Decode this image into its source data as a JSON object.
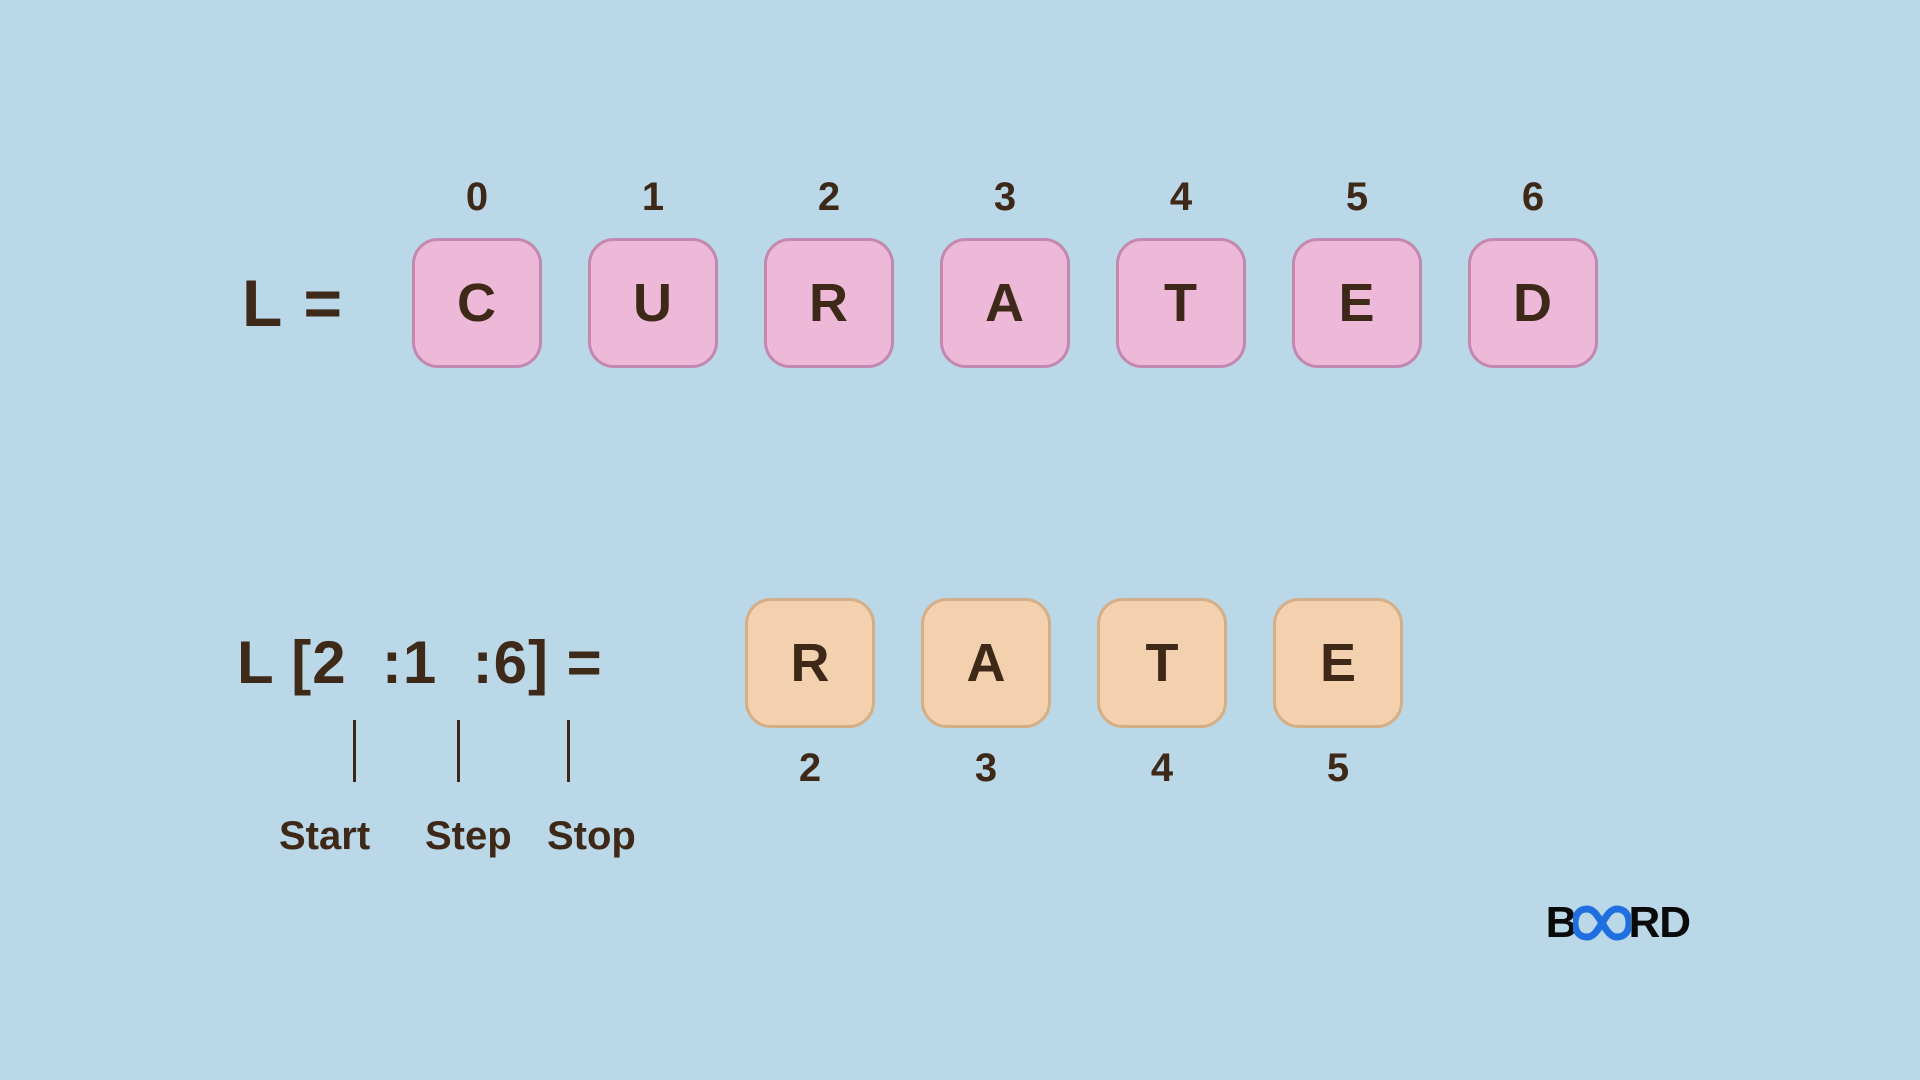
{
  "list": {
    "label": "L =",
    "indices": [
      "0",
      "1",
      "2",
      "3",
      "4",
      "5",
      "6"
    ],
    "letters": [
      "C",
      "U",
      "R",
      "A",
      "T",
      "E",
      "D"
    ]
  },
  "slice": {
    "expr": "L [2  :1  :6] =",
    "letters": [
      "R",
      "A",
      "T",
      "E"
    ],
    "indices": [
      "2",
      "3",
      "4",
      "5"
    ],
    "parts": {
      "start": "Start",
      "step": "Step",
      "stop": "Stop"
    }
  },
  "brand": {
    "left": "B",
    "right": "RD"
  },
  "colors": {
    "bg": "#bbd8e8",
    "text": "#3e2919",
    "pink_fill": "#eeb9d8",
    "pink_border": "#c388b0",
    "peach_fill": "#f3d0ae",
    "peach_border": "#d4ae86",
    "brand_blue": "#1f6fe0"
  }
}
